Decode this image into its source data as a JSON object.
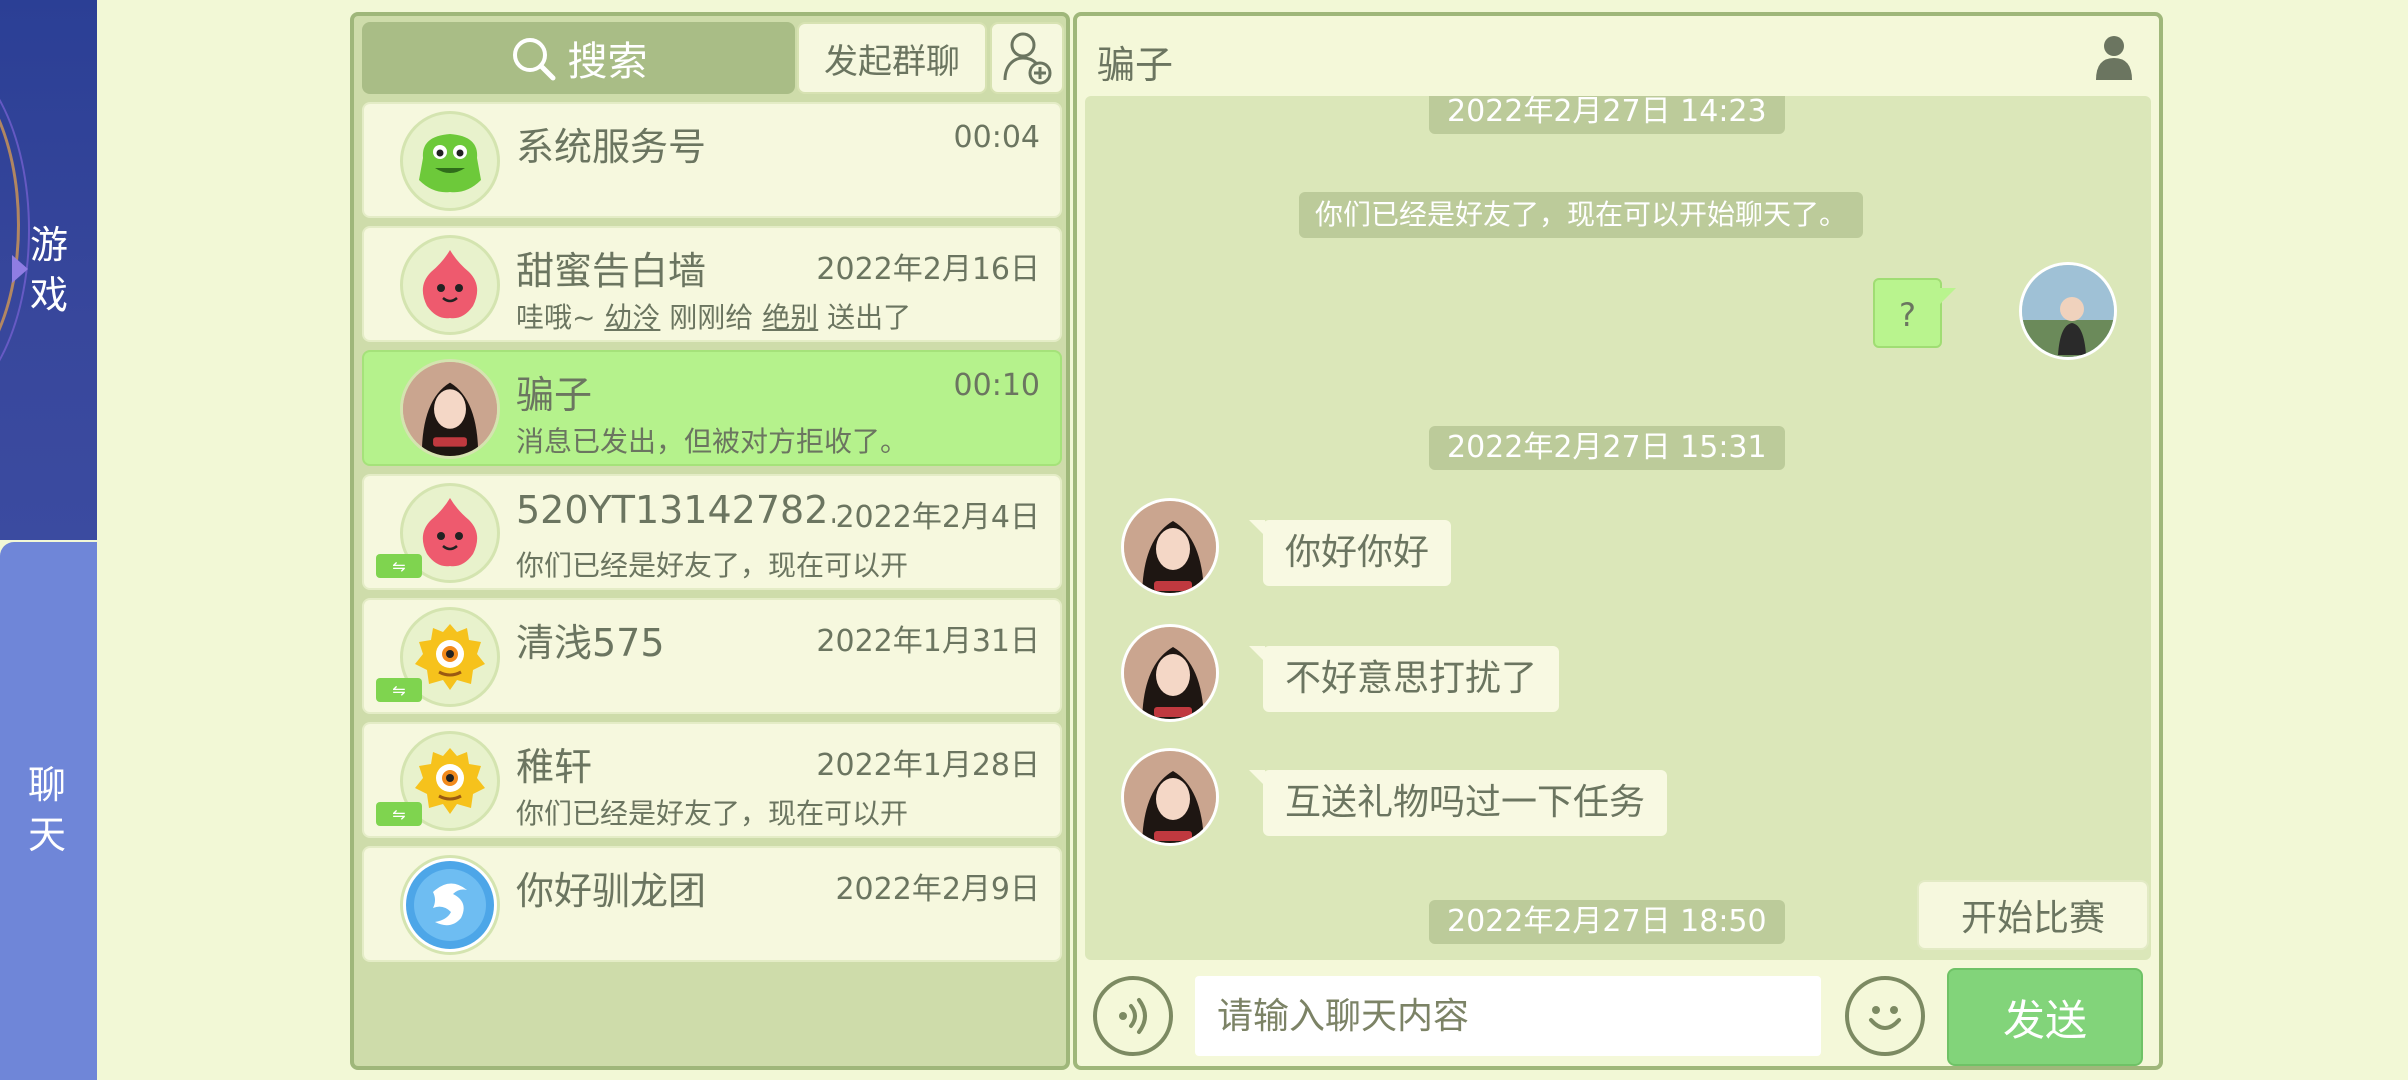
{
  "nav": {
    "game_label": "游\n戏",
    "game_chars": [
      "游",
      "戏"
    ],
    "chat_chars": [
      "聊",
      "天"
    ]
  },
  "list": {
    "search_label": "搜索",
    "group_chat_label": "发起群聊",
    "items": [
      {
        "name": "系统服务号",
        "time": "00:04",
        "preview": "",
        "avatar": "green-monster-avatar"
      },
      {
        "name": "甜蜜告白墙",
        "time": "2022年2月16日",
        "preview_parts": [
          "哇哦~ ",
          "幼泠",
          " 刚刚给 ",
          "绝别",
          " 送出了"
        ],
        "avatar": "pink-blob-avatar"
      },
      {
        "name": "骗子",
        "time": "00:10",
        "preview": "消息已发出，但被对方拒收了。",
        "avatar": "girl-photo-avatar",
        "active": true
      },
      {
        "name": "520YT13142782...",
        "time": "2022年2月4日",
        "preview": "你们已经是好友了，现在可以开",
        "avatar": "pink-blob-avatar",
        "badge": true
      },
      {
        "name": "清浅575",
        "time": "2022年1月31日",
        "preview": "",
        "avatar": "yellow-monster-avatar",
        "badge": true
      },
      {
        "name": "稚轩",
        "time": "2022年1月28日",
        "preview": "你们已经是好友了，现在可以开",
        "avatar": "yellow-monster-avatar",
        "badge": true
      },
      {
        "name": "你好驯龙团",
        "time": "2022年2月9日",
        "preview": "",
        "avatar": "dragon-emblem-avatar"
      }
    ]
  },
  "conversation": {
    "title": "骗子",
    "timestamps": [
      "2022年2月27日 14:23",
      "2022年2月27日 15:31",
      "2022年2月27日 18:50"
    ],
    "system_notice": "你们已经是好友了，现在可以开始聊天了。",
    "outgoing": [
      "?"
    ],
    "incoming": [
      "你好你好",
      "不好意思打扰了",
      "互送礼物吗过一下任务"
    ],
    "start_match_label": "开始比赛",
    "input_placeholder": "请输入聊天内容",
    "send_label": "发送"
  },
  "colors": {
    "background": "#f2f8d6",
    "active_item": "#b5f28c",
    "send_button": "#82d47a",
    "nav_game": "#2b3f95",
    "nav_chat": "#6f86d8"
  }
}
